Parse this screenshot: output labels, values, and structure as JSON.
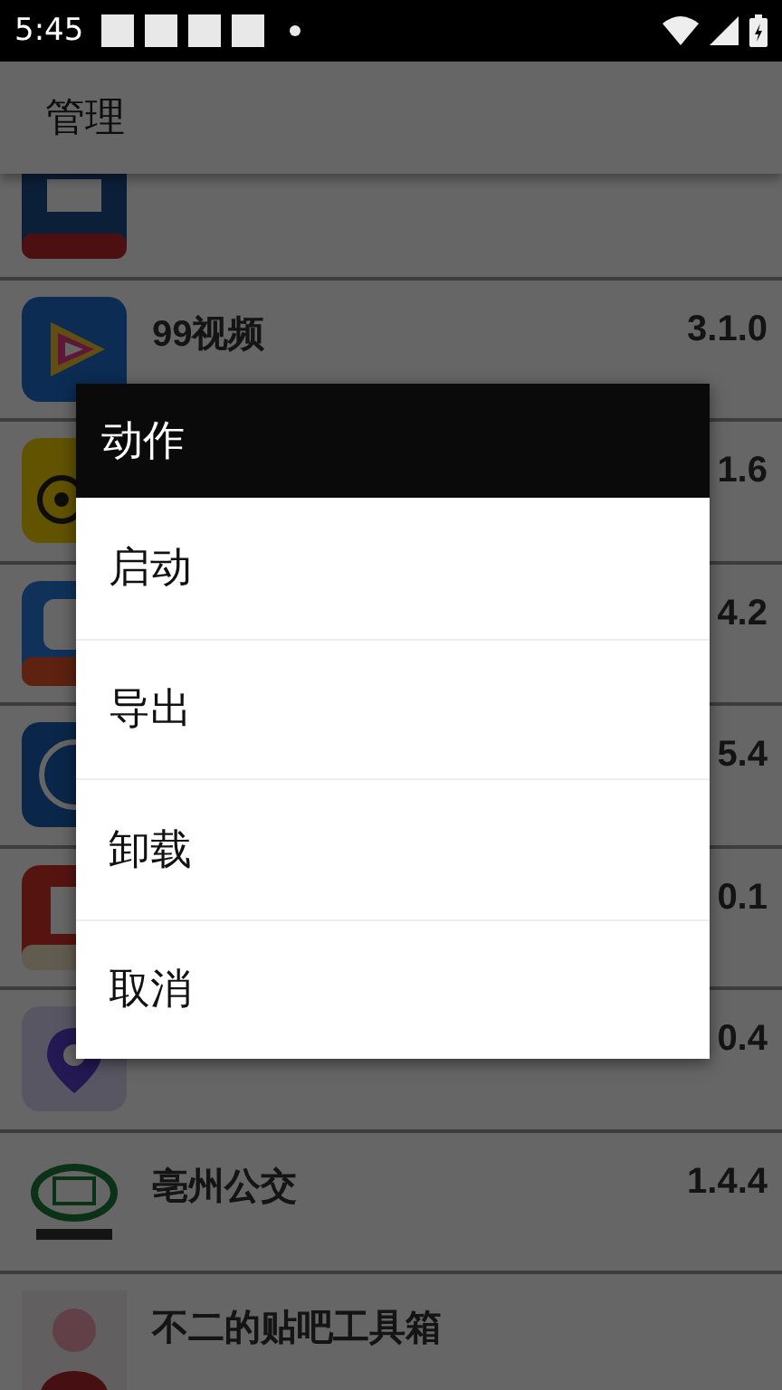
{
  "status_bar": {
    "time": "5:45"
  },
  "app_bar": {
    "title": "管理"
  },
  "apps": [
    {
      "kind": "app"
    },
    {
      "kind": "app",
      "name": "99视频",
      "version": "3.1.0"
    },
    {
      "kind": "app",
      "version": "1.6"
    },
    {
      "kind": "app",
      "version": "4.2"
    },
    {
      "kind": "app",
      "version": "5.4"
    },
    {
      "kind": "app",
      "version": "0.1"
    },
    {
      "kind": "app",
      "version": "0.4"
    },
    {
      "kind": "app",
      "name": "亳州公交",
      "version": "1.4.4"
    },
    {
      "kind": "app",
      "name": "不二的贴吧工具箱"
    }
  ],
  "dialog": {
    "title": "动作",
    "items": [
      {
        "label": "启动"
      },
      {
        "label": "导出"
      },
      {
        "label": "卸载"
      },
      {
        "label": "取消"
      }
    ]
  }
}
